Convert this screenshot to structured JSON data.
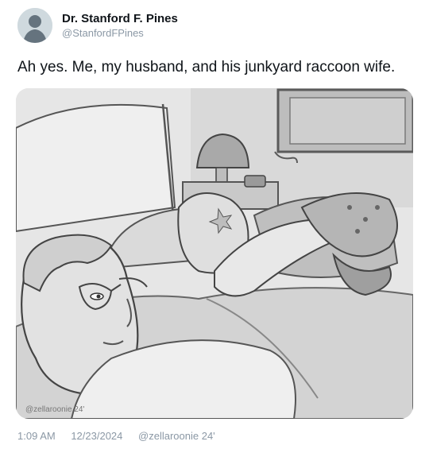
{
  "author": {
    "display_name": "Dr. Stanford F. Pines",
    "handle": "@StanfordFPines"
  },
  "tweet": {
    "text": "Ah yes. Me, my husband, and his junkyard raccoon wife."
  },
  "media": {
    "signature": "@zellaroonie 24'"
  },
  "meta": {
    "time": "1:09 AM",
    "date": "12/23/2024",
    "credit": "@zellaroonie 24'"
  }
}
